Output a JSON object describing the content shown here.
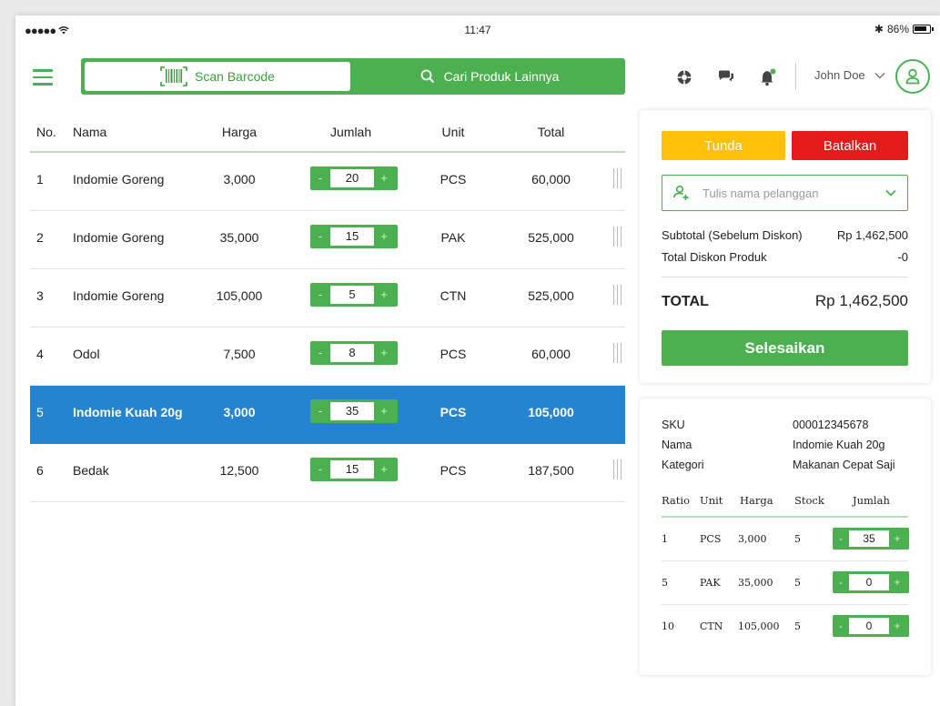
{
  "status_bar": {
    "signal": "●●●●● ",
    "time": "11:47",
    "bluetooth": "✱",
    "battery": "86%"
  },
  "header": {
    "scan_label": "Scan Barcode",
    "find_label": "Cari Produk Lainnya",
    "user_name": "John Doe",
    "accent": "#4caf50"
  },
  "table": {
    "headers": {
      "no": "No.",
      "nama": "Nama",
      "harga": "Harga",
      "jumlah": "Jumlah",
      "unit": "Unit",
      "total": "Total"
    },
    "rows": [
      {
        "no": "1",
        "nama": "Indomie Goreng",
        "harga": "3,000",
        "jumlah": "20",
        "unit": "PCS",
        "total": "60,000"
      },
      {
        "no": "2",
        "nama": "Indomie Goreng",
        "harga": "35,000",
        "jumlah": "15",
        "unit": "PAK",
        "total": "525,000"
      },
      {
        "no": "3",
        "nama": "Indomie Goreng",
        "harga": "105,000",
        "jumlah": "5",
        "unit": "CTN",
        "total": "525,000"
      },
      {
        "no": "4",
        "nama": "Odol",
        "harga": "7,500",
        "jumlah": "8",
        "unit": "PCS",
        "total": "60,000"
      },
      {
        "no": "5",
        "nama": "Indomie Kuah 20g",
        "harga": "3,000",
        "jumlah": "35",
        "unit": "PCS",
        "total": "105,000"
      },
      {
        "no": "6",
        "nama": "Bedak",
        "harga": "12,500",
        "jumlah": "15",
        "unit": "PCS",
        "total": "187,500"
      }
    ],
    "stepper_minus": "-",
    "stepper_plus": "+"
  },
  "summary": {
    "tunda_label": "Tunda",
    "batal_label": "Batalkan",
    "customer_placeholder": "Tulis nama pelanggan",
    "subtotal_label": "Subtotal (Sebelum Diskon)",
    "subtotal_value": "Rp 1,462,500",
    "discount_label": "Total Diskon Produk",
    "discount_value": "-0",
    "total_label": "TOTAL",
    "total_value": "Rp 1,462,500",
    "finish_label": "Selesaikan"
  },
  "detail": {
    "sku_label": "SKU",
    "sku_value": "000012345678",
    "nama_label": "Nama",
    "nama_value": "Indomie Kuah 20g",
    "kategori_label": "Kategori",
    "kategori_value": "Makanan Cepat Saji",
    "headers": {
      "ratio": "Ratio",
      "unit": "Unit",
      "harga": "Harga",
      "stock": "Stock",
      "jumlah": "Jumlah"
    },
    "rows": [
      {
        "ratio": "1",
        "unit": "PCS",
        "harga": "3,000",
        "stock": "5",
        "jumlah": "35"
      },
      {
        "ratio": "5",
        "unit": "PAK",
        "harga": "35,000",
        "stock": "5",
        "jumlah": "0"
      },
      {
        "ratio": "10",
        "unit": "CTN",
        "harga": "105,000",
        "stock": "5",
        "jumlah": "0"
      }
    ]
  }
}
